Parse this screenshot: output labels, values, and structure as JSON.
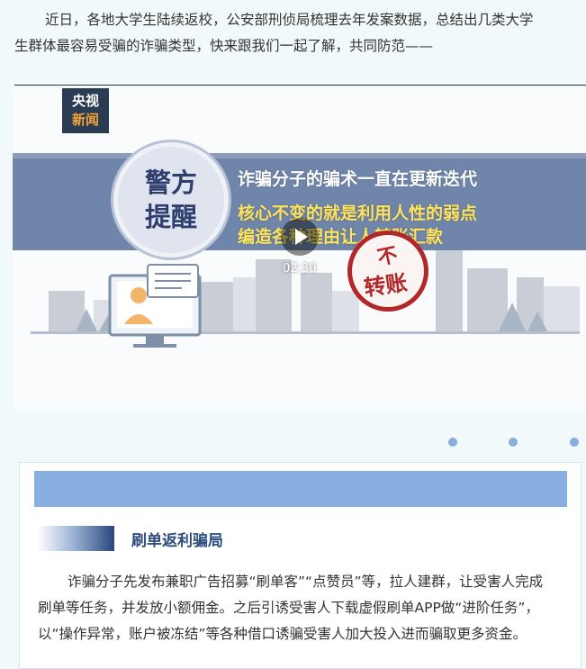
{
  "intro": {
    "line1": "近日，各地大学生陆续返校，公安部刑侦局梳理去年发案数据，总结出几类大学",
    "line2": "生群体最容易受骗的诈骗类型，快来跟我们一起了解，共同防范——"
  },
  "video": {
    "logo_top": "央视",
    "logo_bottom": "新闻",
    "badge_line1": "警方",
    "badge_line2": "提醒",
    "banner_line1": "诈骗分子的骗术一直在更新迭代",
    "banner_line2": "核心不变的就是利用人性的弱点",
    "banner_line3": "编造各种理由让人转账汇款",
    "stamp_line1": "不",
    "stamp_line2": "转账",
    "duration": "02:30",
    "colors": {
      "banner": "#6f86aa",
      "banner_text_highlight": "#ffe35a",
      "stamp": "#b2272a"
    }
  },
  "carousel": {
    "dot_count": 3,
    "dot_color": "#8aaedc"
  },
  "card": {
    "bar_color": "#89aee0",
    "title": "刷单返利骗局",
    "para_line1": "诈骗分子先发布兼职广告招募“刷单客”“点赞员”等，拉人建群，让受害人完成",
    "para_line2": "刷单等任务，并发放小额佣金。之后引诱受害人下载虚假刷单APP做“进阶任务”，",
    "para_line3": "以“操作异常，账户被冻结”等各种借口诱骗受害人加大投入进而骗取更多资金。"
  }
}
